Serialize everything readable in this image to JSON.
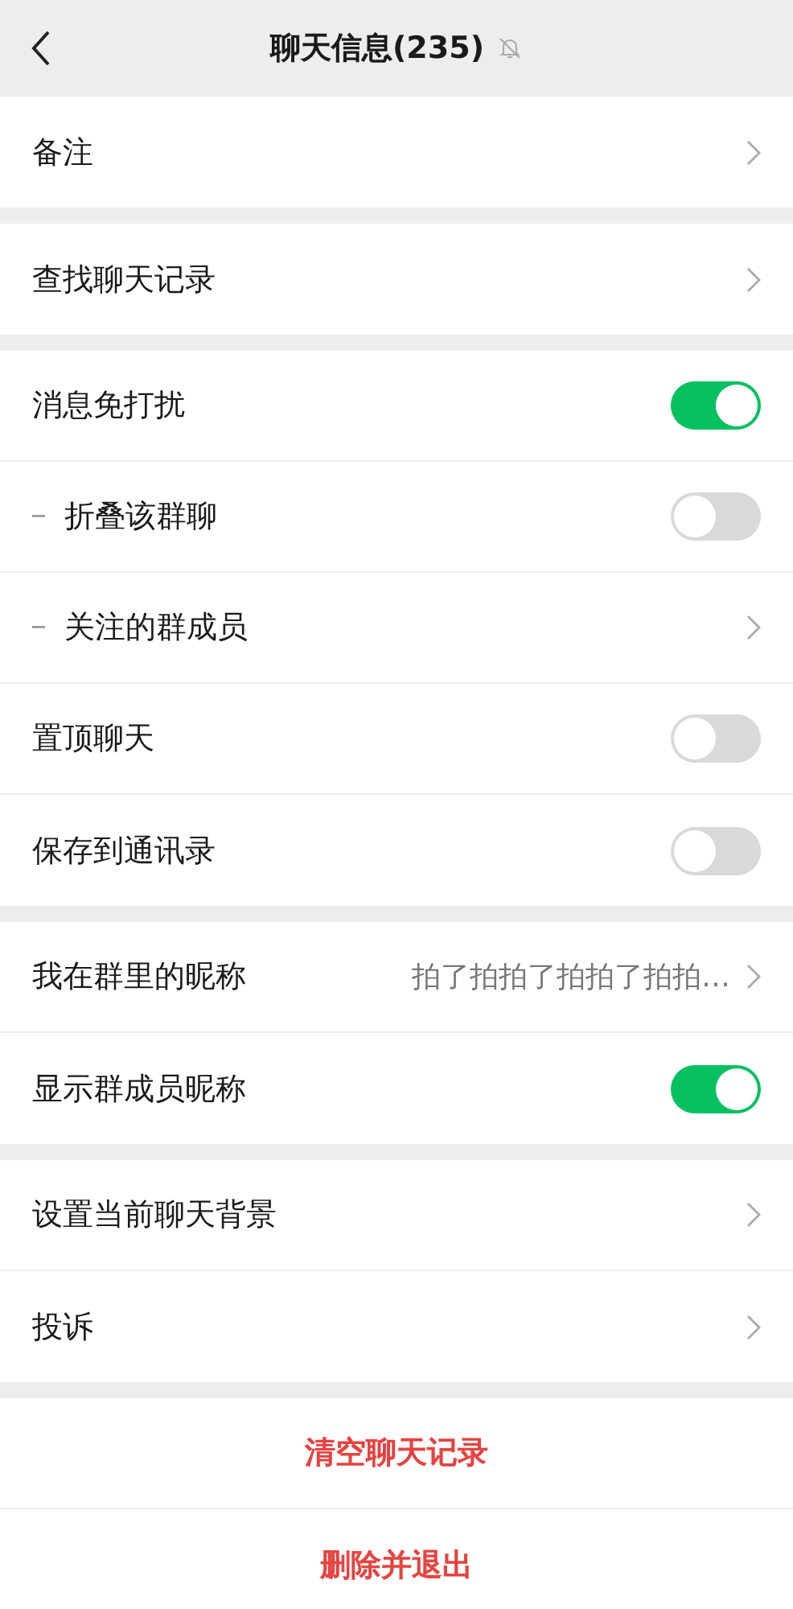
{
  "header": {
    "title": "聊天信息(235)",
    "muted": true
  },
  "sections": [
    {
      "rows": [
        {
          "kind": "link",
          "label": "备注",
          "sub": false
        }
      ]
    },
    {
      "rows": [
        {
          "kind": "link",
          "label": "查找聊天记录",
          "sub": false
        }
      ]
    },
    {
      "rows": [
        {
          "kind": "toggle",
          "label": "消息免打扰",
          "sub": false,
          "on": true
        },
        {
          "kind": "toggle",
          "label": "折叠该群聊",
          "sub": true,
          "on": false
        },
        {
          "kind": "link",
          "label": "关注的群成员",
          "sub": true
        },
        {
          "kind": "toggle",
          "label": "置顶聊天",
          "sub": false,
          "on": false
        },
        {
          "kind": "toggle",
          "label": "保存到通讯录",
          "sub": false,
          "on": false
        }
      ]
    },
    {
      "rows": [
        {
          "kind": "link",
          "label": "我在群里的昵称",
          "sub": false,
          "value": "拍了拍拍了拍拍了拍拍…"
        },
        {
          "kind": "toggle",
          "label": "显示群成员昵称",
          "sub": false,
          "on": true
        }
      ]
    },
    {
      "rows": [
        {
          "kind": "link",
          "label": "设置当前聊天背景",
          "sub": false
        },
        {
          "kind": "link",
          "label": "投诉",
          "sub": false
        }
      ]
    }
  ],
  "actions": [
    "清空聊天记录",
    "删除并退出"
  ]
}
